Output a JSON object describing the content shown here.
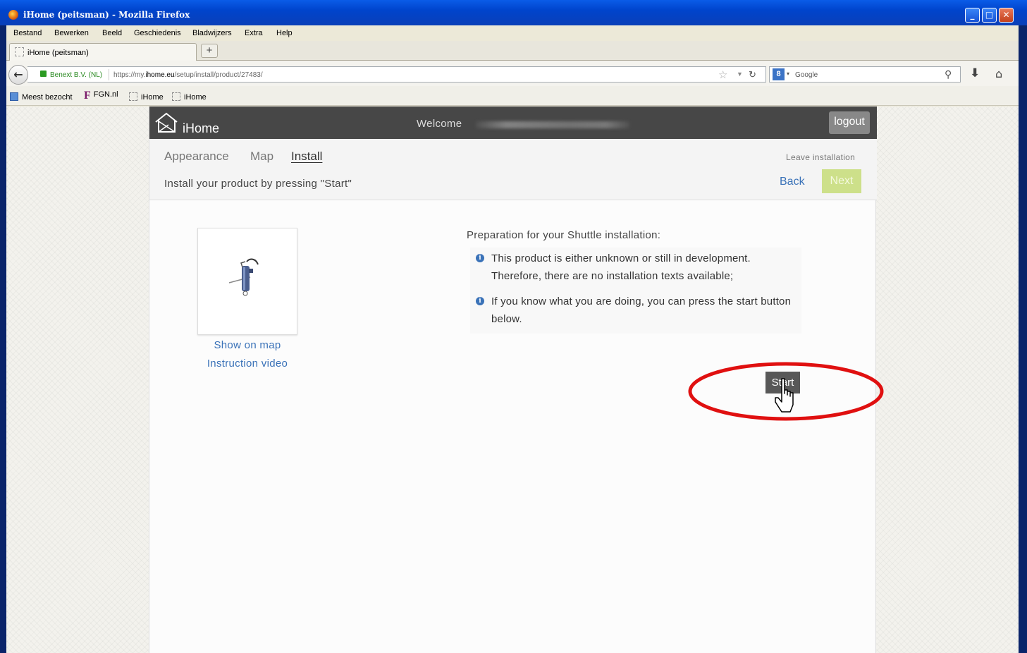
{
  "window": {
    "title": "iHome (peitsman) - Mozilla Firefox"
  },
  "menu": [
    "Bestand",
    "Bewerken",
    "Beeld",
    "Geschiedenis",
    "Bladwijzers",
    "Extra",
    "Help"
  ],
  "tab": {
    "label": "iHome (peitsman)",
    "new_tab": "+"
  },
  "navbar": {
    "identity": "Benext B.V. (NL)",
    "url_prefix": "https://my.",
    "url_domain": "ihome.eu",
    "url_path": "/setup/install/product/27483/",
    "search_placeholder": "Google"
  },
  "bookmarks": [
    "Meest bezocht",
    "FGN.nl",
    "iHome",
    "iHome"
  ],
  "site": {
    "logo_text": "iHome",
    "welcome": "Welcome",
    "logout": "logout",
    "tabs": [
      "Appearance",
      "Map",
      "Install"
    ],
    "active_tab": "Install",
    "leave_installation": "Leave installation",
    "instruction": "Install your product by pressing \"Start\"",
    "back": "Back",
    "next": "Next",
    "show_on_map": "Show on map",
    "instruction_video": "Instruction video",
    "prep_title": "Preparation for your Shuttle installation:",
    "prep_items": [
      "This product is either unknown or still in development. Therefore, there are no installation texts available;",
      "If you know what you are doing, you can press the start button below."
    ],
    "start": "Start"
  },
  "colors": {
    "header": "#474747",
    "link": "#3a72b8",
    "next_disabled": "#cde08a",
    "highlight": "#e01010"
  },
  "icons": [
    "firefox-icon",
    "back-arrow-icon",
    "lock-icon",
    "star-icon",
    "reload-icon",
    "google-icon",
    "search-icon",
    "download-icon",
    "home-icon",
    "house-logo-icon",
    "info-icon",
    "hand-cursor-icon"
  ]
}
